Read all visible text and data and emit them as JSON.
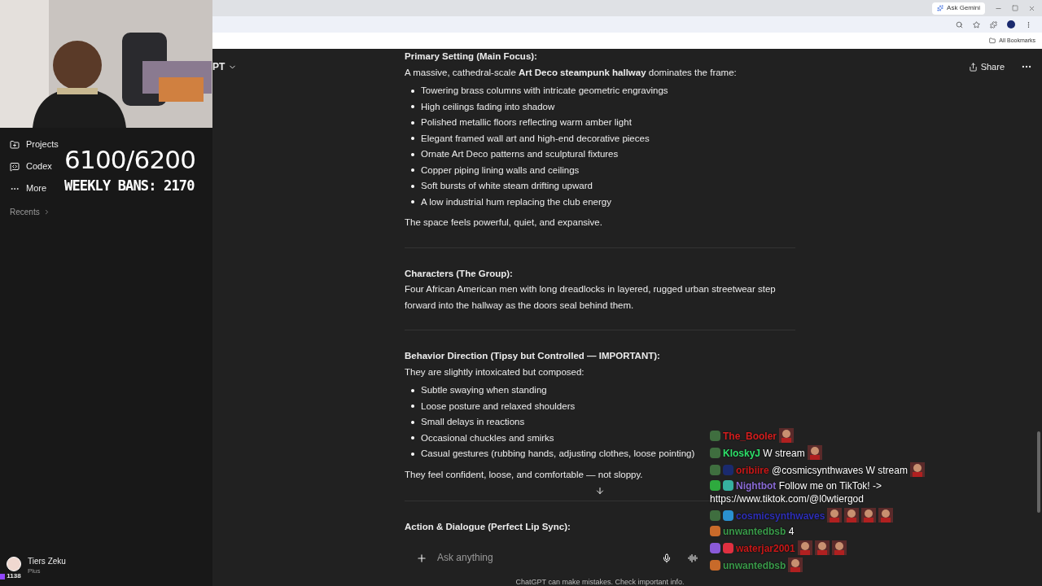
{
  "browser": {
    "ask_button": "Ask Gemini",
    "bookmarks": "All Bookmarks"
  },
  "overlay": {
    "counter": "6100/6200",
    "bans": "WEEKLY BANS: 2170",
    "viewers": "1138"
  },
  "sidebar": {
    "items": [
      {
        "label": "Projects",
        "kind": "folder"
      },
      {
        "label": "Codex",
        "kind": "codex"
      },
      {
        "label": "More",
        "kind": "more"
      }
    ],
    "recents": "Recents",
    "user": {
      "name": "Tiers Zeku",
      "plan": "Plus"
    }
  },
  "header": {
    "model": "PT",
    "share": "Share"
  },
  "sections": [
    {
      "heading": "Primary Setting (Main Focus):",
      "intro": "A massive, cathedral-scale **Art Deco steampunk hallway** dominates the frame:",
      "bullets": [
        "Towering brass columns with intricate geometric engravings",
        "High ceilings fading into shadow",
        "Polished metallic floors reflecting warm amber light",
        "Elegant framed wall art and high-end decorative pieces",
        "Ornate Art Deco patterns and sculptural fixtures",
        "Copper piping lining walls and ceilings",
        "Soft bursts of white steam drifting upward",
        "A low industrial hum replacing the club energy"
      ],
      "outro": "The space feels powerful, quiet, and expansive."
    },
    {
      "heading": "Characters (The Group):",
      "intro": "Four African American men with long dreadlocks in layered, rugged urban streetwear step forward into the hallway as the doors seal behind them."
    },
    {
      "heading": "Behavior Direction (Tipsy but Controlled — IMPORTANT):",
      "intro": "They are slightly intoxicated but composed:",
      "bullets": [
        "Subtle swaying when standing",
        "Loose posture and relaxed shoulders",
        "Small delays in reactions",
        "Occasional chuckles and smirks",
        "Casual gestures (rubbing hands, adjusting clothes, loose pointing)"
      ],
      "outro": "They feel confident, loose, and comfortable — not sloppy."
    },
    {
      "heading": "Action & Dialogue (Perfect Lip Sync):"
    }
  ],
  "composer": {
    "placeholder": "Ask anything",
    "disclaimer": "ChatGPT can make mistakes. Check important info."
  },
  "chat": [
    {
      "user": "The_Booler",
      "color": "#d41e1e",
      "badges": [
        {
          "kind": "hood"
        }
      ],
      "emotes": [
        {
          "kind": "picture"
        }
      ]
    },
    {
      "user": "KloskyJ",
      "color": "#2ee06a",
      "badges": [
        {
          "kind": "hood"
        }
      ],
      "text": "W stream",
      "emotes": [
        {
          "kind": "picture"
        }
      ]
    },
    {
      "user": "oribiire",
      "color": "#c81818",
      "badges": [
        {
          "kind": "hood"
        },
        {
          "kind": "planet"
        }
      ],
      "text": "@cosmicsynthwaves W stream",
      "emotes": [
        {
          "kind": "picture"
        }
      ]
    },
    {
      "user": "Nightbot",
      "color": "#8a6bd6",
      "badges": [
        {
          "kind": "sword"
        },
        {
          "kind": "bot"
        }
      ],
      "text": "Follow me on TikTok! -> https://www.tiktok.com/@l0wtiergod"
    },
    {
      "user": "cosmicsynthwaves",
      "color": "#2e2fb8",
      "badges": [
        {
          "kind": "hood"
        },
        {
          "kind": "crown"
        }
      ],
      "emotes": [
        {
          "kind": "picture"
        },
        {
          "kind": "picture"
        },
        {
          "kind": "picture"
        },
        {
          "kind": "picture"
        }
      ]
    },
    {
      "user": "unwantedbsb",
      "color": "#3a9a4a",
      "badges": [
        {
          "kind": "medal"
        }
      ],
      "text": "4"
    },
    {
      "user": "waterjar2001",
      "color": "#c81818",
      "badges": [
        {
          "kind": "paw"
        },
        {
          "kind": "heart"
        }
      ],
      "emotes": [
        {
          "kind": "picture"
        },
        {
          "kind": "picture"
        },
        {
          "kind": "picture"
        }
      ]
    },
    {
      "user": "unwantedbsb",
      "color": "#3a9a4a",
      "badges": [
        {
          "kind": "medal"
        }
      ],
      "emotes": [
        {
          "kind": "picture"
        }
      ]
    }
  ]
}
